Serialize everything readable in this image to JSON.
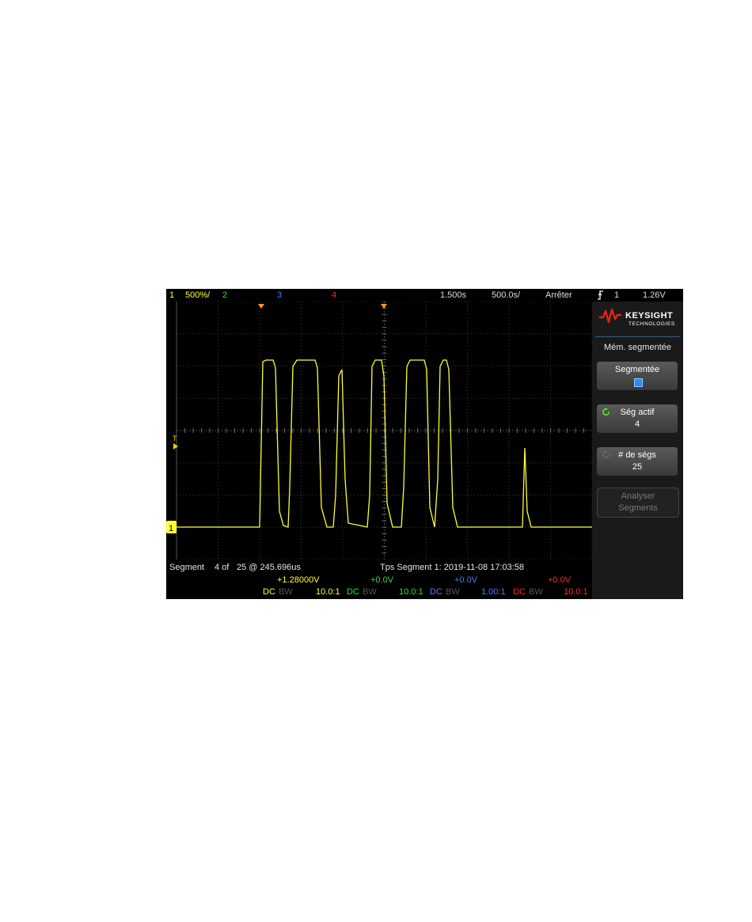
{
  "status": {
    "ch1_num": "1",
    "ch1_scale": "500%/",
    "ch2_num": "2",
    "ch3_num": "3",
    "ch4_num": "4",
    "time_delay": "1.500s",
    "time_scale": "500.0s/",
    "run_state": "Arrêter",
    "trigger_icon": "trigger-edge-icon",
    "trigger_channel": "1",
    "trigger_level": "1.26V"
  },
  "markers": {
    "trigger_level_label": "T",
    "ch1_ground_label": "1"
  },
  "segment_bar": {
    "label": "Segment",
    "index": "4 of",
    "count_time": "25 @ 245.696us",
    "timestamp": "Tps Segment 1: 2019-11-08 17:03:58"
  },
  "channels": [
    {
      "offset": "+1.28000V",
      "coupling": "DC",
      "bw": "BW",
      "probe": "10.0:1",
      "color": "#ffff33"
    },
    {
      "offset": "+0.0V",
      "coupling": "DC",
      "bw": "BW",
      "probe": "10.0:1",
      "color": "#33dd33"
    },
    {
      "offset": "+0.0V",
      "coupling": "DC",
      "bw": "BW",
      "probe": "1.00:1",
      "color": "#5577ff"
    },
    {
      "offset": "+0.0V",
      "coupling": "DC",
      "bw": "BW",
      "probe": "10.0:1",
      "color": "#ff2a2a"
    }
  ],
  "panel": {
    "logo_text": "KEYSIGHT",
    "logo_sub": "TECHNOLOGIES",
    "menu_title": "Mém. segmentée",
    "softkeys": [
      {
        "line1": "Segmentée",
        "line2": "",
        "state": "on"
      },
      {
        "line1": "Ség actif",
        "line2": "4"
      },
      {
        "line1": "# de ségs",
        "line2": "25"
      },
      {
        "line1": "Analyser",
        "line2": "Segments"
      }
    ]
  },
  "colors": {
    "ch1": "#ffff33",
    "ch2": "#33dd33",
    "ch3": "#5577ff",
    "ch4": "#ff2a2a",
    "marker_orange": "#ff9a1a",
    "knob_green": "#55dd22",
    "logo_red": "#e0241b"
  }
}
